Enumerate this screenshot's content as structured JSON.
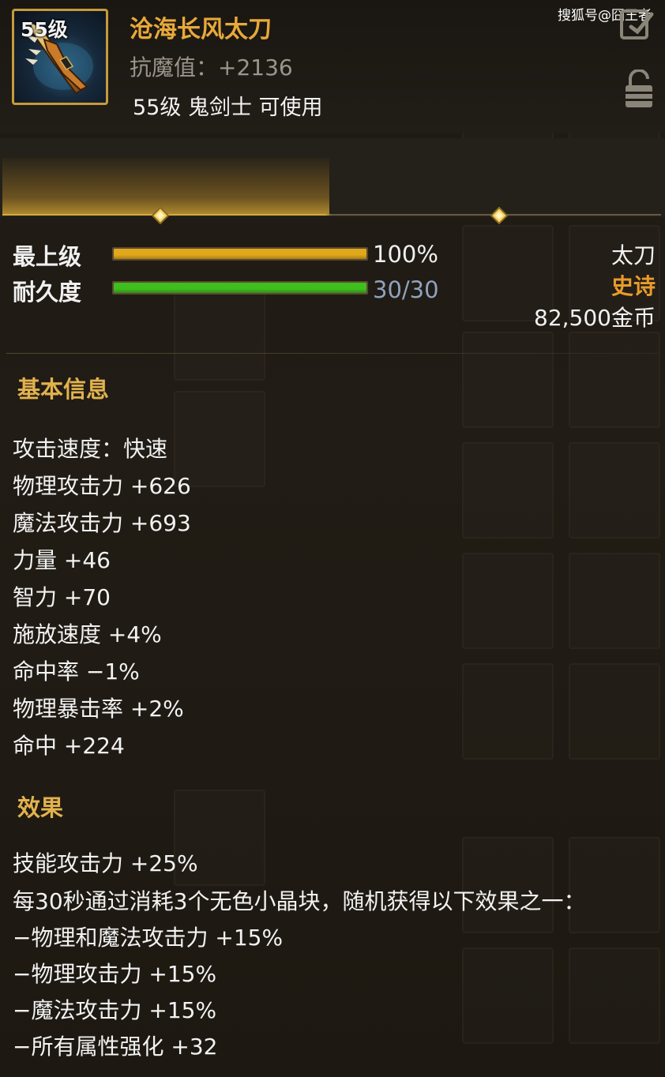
{
  "watermark": "搜狐号@囧王者",
  "item": {
    "level_badge": "55级",
    "name": "沧海长风太刀",
    "resist": "抗魔值：+2136",
    "requirement": "55级 鬼剑士 可使用",
    "icon": "katana-weapon-icon"
  },
  "bars": [
    {
      "label": "最上级",
      "value": "100%",
      "fraction": 1.0,
      "color": "#e0a81a"
    },
    {
      "label": "耐久度",
      "value": "30/30",
      "fraction": 1.0,
      "color": "#3fbf1e"
    }
  ],
  "info": {
    "type": "太刀",
    "rarity": "史诗",
    "rarity_color": "#e89c2a",
    "price": "82,500金币"
  },
  "basic": {
    "title": "基本信息",
    "lines": [
      "攻击速度：快速",
      "物理攻击力 +626",
      "魔法攻击力 +693",
      "力量 +46",
      "智力 +70",
      "施放速度 +4%",
      "命中率 −1%",
      "物理暴击率 +2%",
      "命中 +224"
    ]
  },
  "effects": {
    "title": "效果",
    "lines": [
      "技能攻击力 +25%",
      "每30秒通过消耗3个无色小晶块，随机获得以下效果之一：",
      "−物理和魔法攻击力 +15%",
      "−物理攻击力 +15%",
      "−魔法攻击力 +15%",
      "−所有属性强化 +32"
    ]
  }
}
